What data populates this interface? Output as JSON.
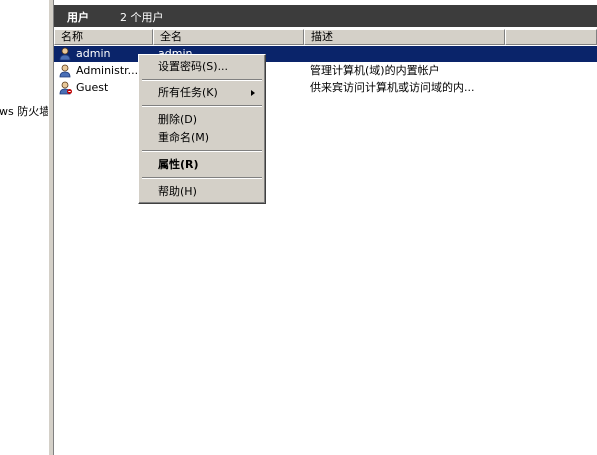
{
  "left_pane": {
    "truncated_text": "ws 防火墙"
  },
  "title_bar": {
    "title": "用户",
    "count": "2 个用户"
  },
  "columns": {
    "name": "名称",
    "fullname": "全名",
    "description": "描述"
  },
  "rows": [
    {
      "name": "admin",
      "fullname": "admin",
      "description": ""
    },
    {
      "name": "Administr...",
      "fullname": "",
      "description": "管理计算机(域)的内置帐户"
    },
    {
      "name": "Guest",
      "fullname": "",
      "description": "供来宾访问计算机或访问域的内..."
    }
  ],
  "context_menu": {
    "set_password": "设置密码(S)...",
    "all_tasks": "所有任务(K)",
    "delete": "删除(D)",
    "rename": "重命名(M)",
    "properties": "属性(R)",
    "help": "帮助(H)"
  },
  "colors": {
    "selection": "#0a246a",
    "title_bg": "#3c3c3c",
    "menu_bg": "#d4d0c8"
  },
  "icons": {
    "user": "user-icon",
    "submenu_arrow": "submenu-arrow-icon"
  }
}
